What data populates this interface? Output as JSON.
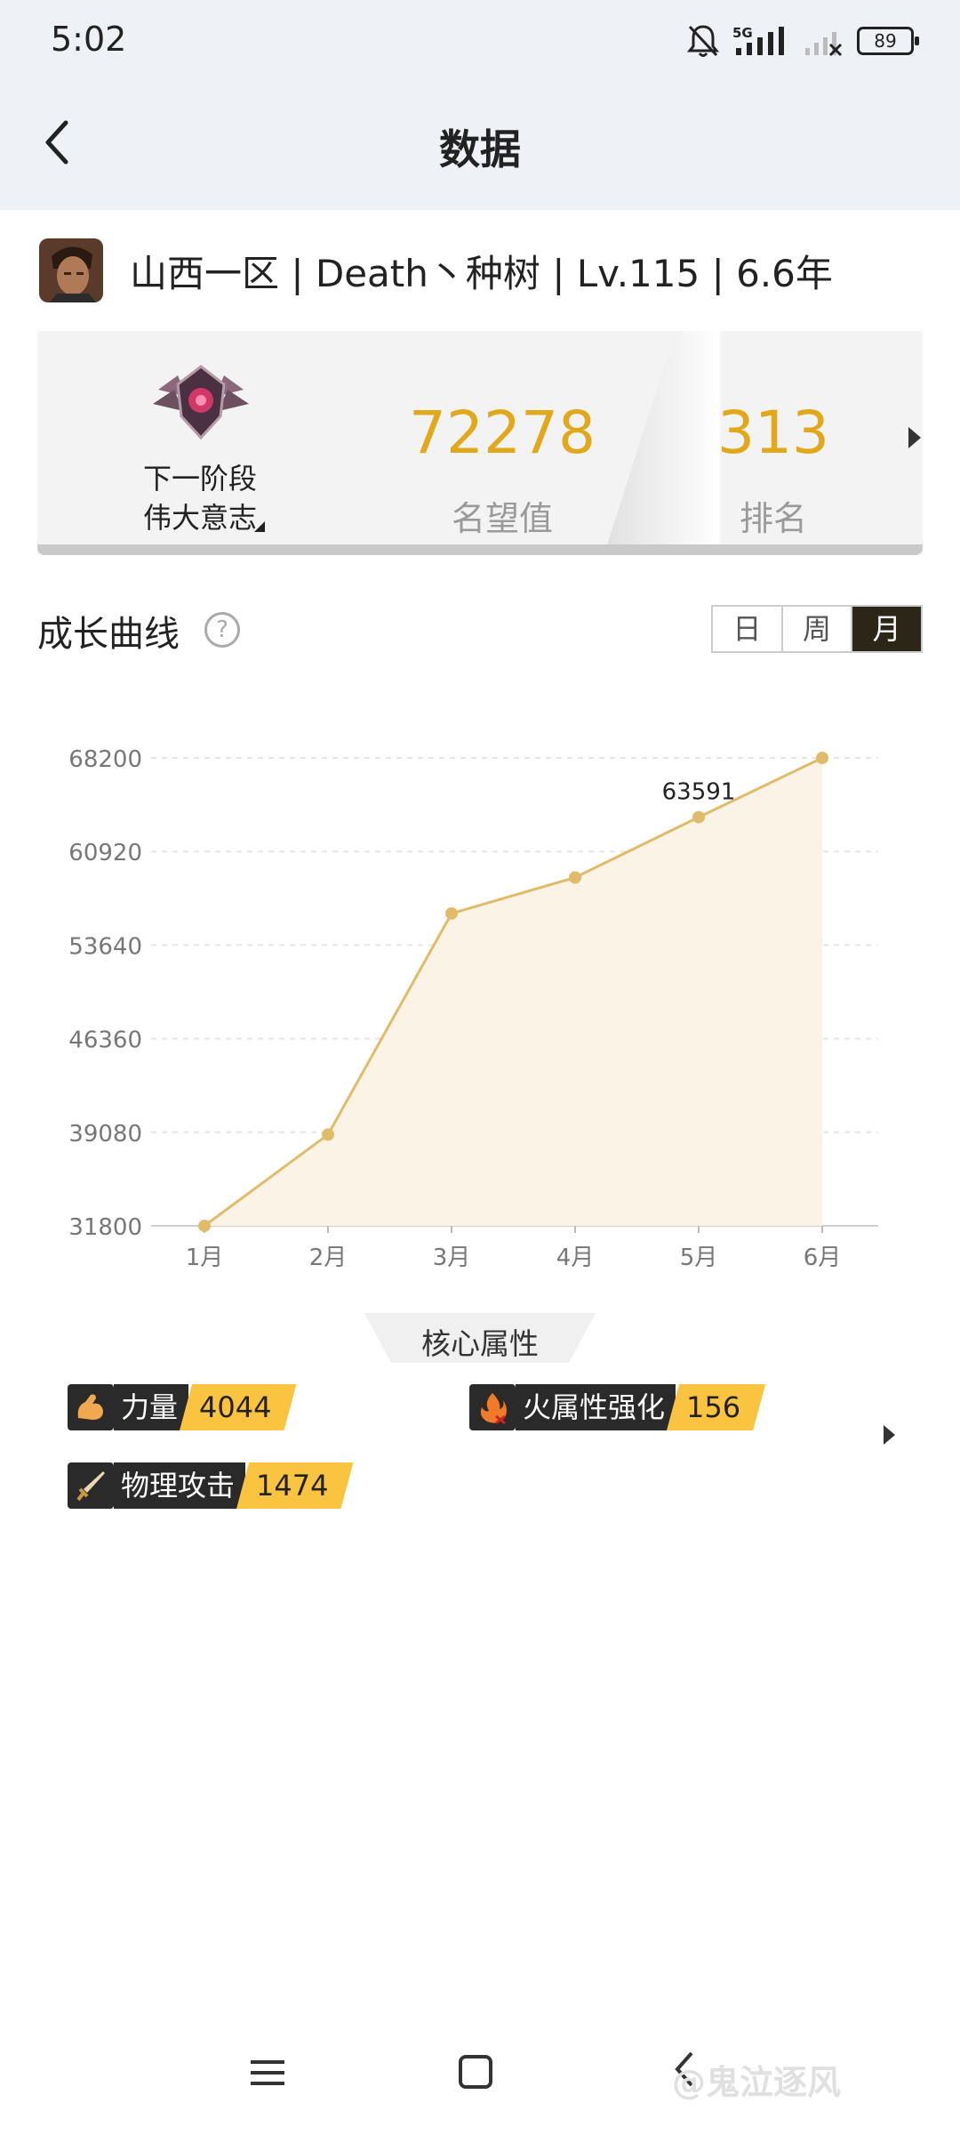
{
  "status_bar": {
    "time": "5:02",
    "network": "5G",
    "battery": "89"
  },
  "nav": {
    "title": "数据"
  },
  "profile": {
    "line": "山西一区 | Death丶种树 | Lv.115 | 6.6年"
  },
  "summary": {
    "next_stage_line1": "下一阶段",
    "next_stage_line2": "伟大意志",
    "prestige_value": "72278",
    "prestige_label": "名望值",
    "rank_value": "313",
    "rank_label": "排名"
  },
  "growth": {
    "title": "成长曲线",
    "help": "?",
    "periods": [
      "日",
      "周",
      "月"
    ],
    "active_period": "月"
  },
  "chart_data": {
    "type": "area",
    "categories": [
      "1月",
      "2月",
      "3月",
      "4月",
      "5月",
      "6月"
    ],
    "values": [
      31800,
      38900,
      56100,
      58900,
      63591,
      68200
    ],
    "yticks": [
      "68200",
      "60920",
      "53640",
      "46360",
      "39080",
      "31800"
    ],
    "ylim": [
      31800,
      68200
    ],
    "annotation": {
      "label": "63591",
      "index": 4
    },
    "grid": true,
    "colors": {
      "line": "#e0bb6a",
      "fill": "#fbf4e6",
      "grid": "#e6e6e6"
    }
  },
  "core": {
    "title": "核心属性",
    "attributes": [
      {
        "name": "力量",
        "value": "4044",
        "icon": "arm-icon"
      },
      {
        "name": "火属性强化",
        "value": "156",
        "icon": "fire-icon"
      },
      {
        "name": "物理攻击",
        "value": "1474",
        "icon": "sword-icon"
      }
    ]
  },
  "watermark": "@鬼泣逐风"
}
